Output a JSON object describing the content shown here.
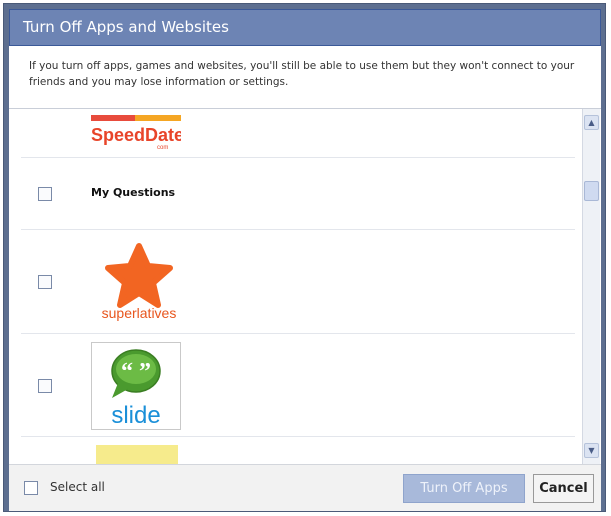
{
  "dialog": {
    "title": "Turn Off Apps and Websites",
    "description": "If you turn off apps, games and websites, you'll still be able to use them but they won't connect to your friends and you may lose information or settings."
  },
  "apps": [
    {
      "name": "SpeedDate",
      "logo_text": "SpeedDate",
      "logo_sub": "com"
    },
    {
      "name": "My Questions"
    },
    {
      "name": "superlatives",
      "logo_text": "superlatives"
    },
    {
      "name": "slide",
      "logo_text": "slide",
      "logo_bubble": "“ ”"
    },
    {
      "name": ""
    }
  ],
  "footer": {
    "select_all_label": "Select all",
    "turn_off_label": "Turn Off Apps",
    "cancel_label": "Cancel"
  },
  "colors": {
    "title_bar": "#6d84b4",
    "primary_button": "#a8b9da",
    "superlatives_orange": "#f26522",
    "slide_green": "#4a9a2e",
    "slide_blue": "#1a8fd8"
  },
  "icons": {
    "scroll_up": "chevron-up-icon",
    "scroll_down": "chevron-down-icon",
    "star": "star-icon",
    "speech_bubble": "speech-bubble-icon"
  }
}
